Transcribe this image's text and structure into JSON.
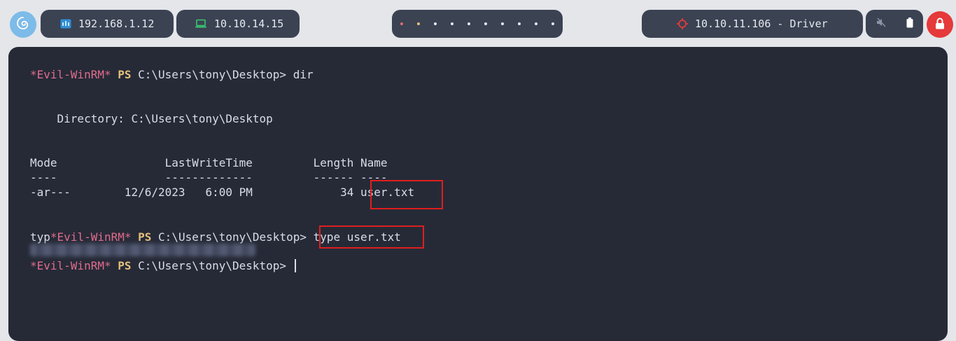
{
  "topbar": {
    "host_ip": "192.168.1.12",
    "vpn_ip": "10.10.14.15",
    "workspace_count": 10,
    "target_label": "10.10.11.106 - Driver"
  },
  "colors": {
    "accent_os": "#7dbbe8",
    "prompt_name": "#e06c8c",
    "prompt_ps": "#e5c07b",
    "terminal_bg": "#262a37",
    "highlight_box": "#e01e1e",
    "power_button": "#e5393a"
  },
  "icons": {
    "os": "debian-swirl-icon",
    "host": "network-icon",
    "vpn": "laptop-icon",
    "target": "target-crosshair-icon",
    "mute": "speaker-muted-icon",
    "battery": "battery-icon",
    "power": "lock-icon"
  },
  "terminal": {
    "prompt_name": "*Evil-WinRM*",
    "prompt_ps": "PS",
    "cwd": "C:\\Users\\tony\\Desktop>",
    "cmd1": "dir",
    "directory_line": "    Directory: C:\\Users\\tony\\Desktop",
    "header_line": "Mode                LastWriteTime         Length Name",
    "separator_line": "----                -------------         ------ ----",
    "row_meta": "-ar---        12/6/2023   6:00 PM             34 ",
    "row_name": "user.txt",
    "typed_prefix": "typ",
    "cmd2": "type user.txt"
  }
}
